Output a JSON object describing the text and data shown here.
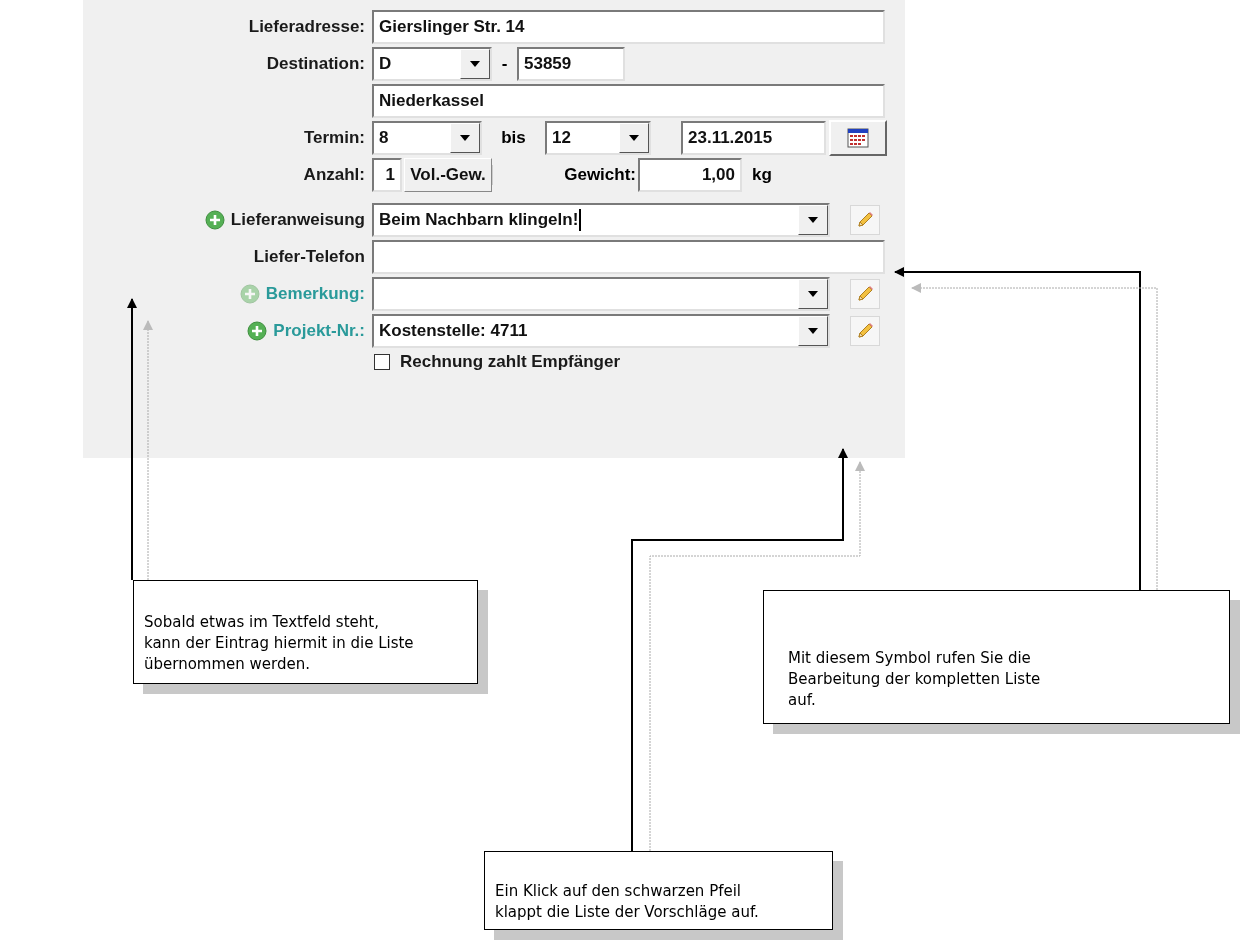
{
  "form": {
    "address": {
      "label": "Lieferadresse:",
      "value": "Gierslinger Str. 14"
    },
    "destination": {
      "label": "Destination:",
      "country": "D",
      "separator": "-",
      "zip": "53859"
    },
    "city": {
      "value": "Niederkassel"
    },
    "termin": {
      "label": "Termin:",
      "from": "8",
      "to_label": "bis",
      "to": "12",
      "date": "23.11.2015"
    },
    "anzahl": {
      "label": "Anzahl:",
      "value": "1",
      "button": "Vol.-Gew.",
      "weight_label": "Gewicht:",
      "weight": "1,00",
      "unit": "kg"
    },
    "rows": [
      {
        "kind": "combo",
        "label": "Lieferanweisung",
        "value": "Beim Nachbarn klingeln!",
        "add_enabled": true,
        "focused": true,
        "color": "#1a1a1a"
      },
      {
        "kind": "text",
        "label": "Liefer-Telefon",
        "color": "#1a1a1a"
      },
      {
        "kind": "combo",
        "label": "Bemerkung:",
        "add_enabled": false,
        "focused": false,
        "color": "#2a9a9a"
      },
      {
        "kind": "combo",
        "label": "Projekt-Nr.:",
        "value": "Kostenstelle: 4711",
        "add_enabled": true,
        "focused": false,
        "color": "#2a9a9a"
      }
    ],
    "checkbox": {
      "label": "Rechnung zahlt Empfänger",
      "checked": false
    }
  },
  "callouts": [
    {
      "text": "Sobald etwas im Textfeld steht,\nkann der Eintrag hiermit in die Liste\nübernommen werden."
    },
    {
      "text": "Mit diesem Symbol rufen Sie die\nBearbeitung der kompletten Liste\nauf."
    },
    {
      "text": "Ein Klick auf den schwarzen Pfeil\nklappt die Liste der Vorschläge auf."
    }
  ]
}
